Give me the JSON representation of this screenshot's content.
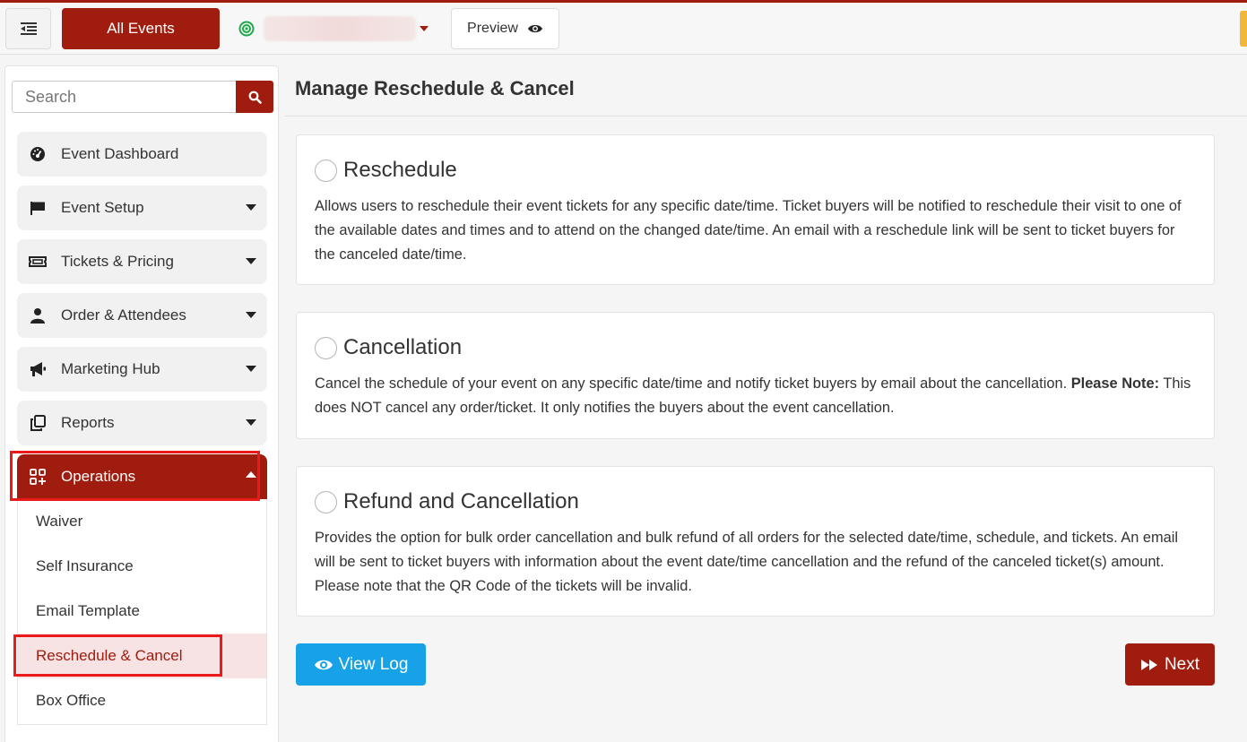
{
  "topbar": {
    "all_events_label": "All Events",
    "preview_label": "Preview"
  },
  "sidebar": {
    "search_placeholder": "Search",
    "items": [
      {
        "label": "Event Dashboard",
        "icon": "dashboard-icon"
      },
      {
        "label": "Event Setup",
        "icon": "flag-icon"
      },
      {
        "label": "Tickets & Pricing",
        "icon": "ticket-icon"
      },
      {
        "label": "Order & Attendees",
        "icon": "user-icon"
      },
      {
        "label": "Marketing Hub",
        "icon": "megaphone-icon"
      },
      {
        "label": "Reports",
        "icon": "reports-icon"
      },
      {
        "label": "Operations",
        "icon": "operations-icon"
      }
    ],
    "operations_sub": [
      "Waiver",
      "Self Insurance",
      "Email Template",
      "Reschedule & Cancel",
      "Box Office"
    ]
  },
  "main": {
    "title": "Manage Reschedule & Cancel",
    "options": [
      {
        "title": "Reschedule",
        "desc": "Allows users to reschedule their event tickets for any specific date/time. Ticket buyers will be notified to reschedule their visit to one of the available dates and times and to attend on the changed date/time. An email with a reschedule link will be sent to ticket buyers for the canceled date/time."
      },
      {
        "title": "Cancellation",
        "desc_pre": "Cancel the schedule of your event on any specific date/time and notify ticket buyers by email about the cancellation. ",
        "desc_bold": "Please Note:",
        "desc_post": " This does NOT cancel any order/ticket. It only notifies the buyers about the event cancellation."
      },
      {
        "title": "Refund and Cancellation",
        "desc": "Provides the option for bulk order cancellation and bulk refund of all orders for the selected date/time, schedule, and tickets. An email will be sent to ticket buyers with information about the event date/time cancellation and the refund of the canceled ticket(s) amount. Please note that the QR Code of the tickets will be invalid."
      }
    ],
    "view_log_label": "View Log",
    "next_label": "Next"
  },
  "colors": {
    "brand": "#a01c0e",
    "view_log": "#17a2e8",
    "highlight": "#ea1a1a",
    "status": "#1fa84a"
  }
}
